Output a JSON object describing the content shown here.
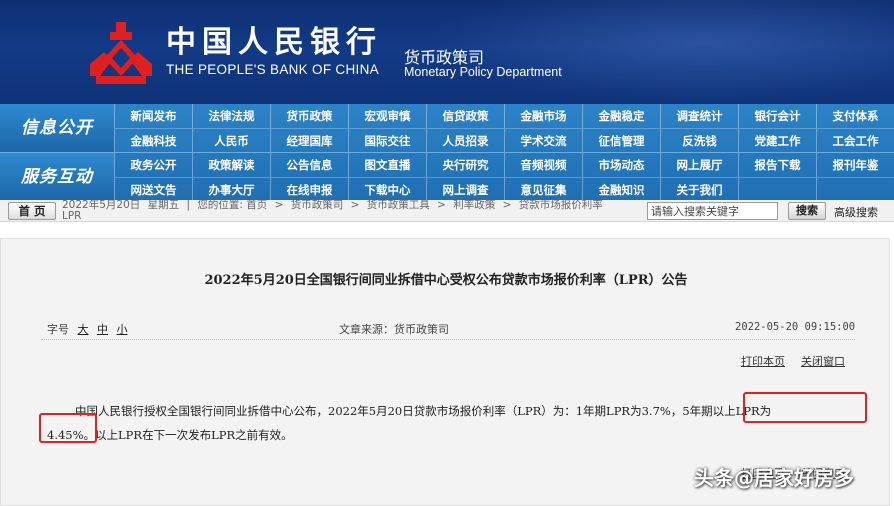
{
  "header": {
    "org_cn": "中国人民银行",
    "org_en": "THE PEOPLE'S BANK OF CHINA",
    "dept_cn": "货币政策司",
    "dept_en": "Monetary Policy Department",
    "logo_icon": "pboc-emblem-icon",
    "colors": {
      "banner": "#123a86",
      "nav": "#2478bd",
      "logo": "#e01f1f"
    }
  },
  "nav": {
    "sections": [
      {
        "title": "信息公开",
        "rows": [
          [
            "新闻发布",
            "法律法规",
            "货币政策",
            "宏观审慎",
            "信贷政策",
            "金融市场",
            "金融稳定",
            "调查统计",
            "银行会计",
            "支付体系"
          ],
          [
            "金融科技",
            "人民币",
            "经理国库",
            "国际交往",
            "人员招录",
            "学术交流",
            "征信管理",
            "反洗钱",
            "党建工作",
            "工会工作"
          ]
        ]
      },
      {
        "title": "服务互动",
        "rows": [
          [
            "政务公开",
            "政策解读",
            "公告信息",
            "图文直播",
            "央行研究",
            "音频视频",
            "市场动态",
            "网上展厅",
            "报告下载",
            "报刊年鉴"
          ],
          [
            "网送文告",
            "办事大厅",
            "在线申报",
            "下载中心",
            "网上调查",
            "意见征集",
            "金融知识",
            "关于我们",
            "",
            ""
          ]
        ]
      }
    ]
  },
  "crumbbar": {
    "home_label": "首 页",
    "date": "2022年5月20日",
    "weekday": "星期五",
    "location_label": "您的位置:",
    "crumbs": [
      "首页",
      "货币政策司",
      "货币政策工具",
      "利率政策",
      "贷款市场报价利率",
      "LPR"
    ],
    "search_placeholder": "请输入搜索关键字",
    "search_button": "搜索",
    "advanced_search": "高级搜索"
  },
  "article": {
    "title": "2022年5月20日全国银行间同业拆借中心受权公布贷款市场报价利率（LPR）公告",
    "font_size_label": "字号",
    "font_sizes": [
      "大",
      "中",
      "小"
    ],
    "source": "文章来源：货币政策司",
    "datetime": "2022-05-20 09:15:00",
    "print_label": "打印本页",
    "close_label": "关闭窗口",
    "body_part1": "中国人民银行授权全国银行间同业拆借中心公布，2022年5月20日贷款市场报价利率（LPR）为：1年期LPR为3.7%，",
    "body_hl1": "5年期以上LPR为",
    "body_hl2": "4.45%。",
    "body_part2": "以上LPR在下一次发布LPR之前有效。",
    "highlight_color": "#e3211d"
  },
  "watermark": "头条@居家好房多"
}
